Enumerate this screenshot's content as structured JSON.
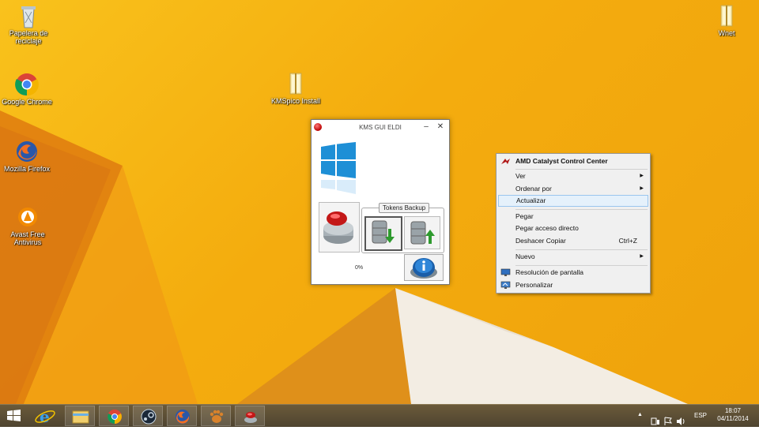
{
  "desktop": {
    "icons": [
      {
        "label": "Papelera de reciclaje",
        "icon": "recycle-bin-icon"
      },
      {
        "label": "Google Chrome",
        "icon": "chrome-icon"
      },
      {
        "label": "Mozilla Firefox",
        "icon": "firefox-icon"
      },
      {
        "label": "Avast Free Antivirus",
        "icon": "avast-icon"
      },
      {
        "label": "KMSpico Install",
        "icon": "folder-icon"
      },
      {
        "label": "Wnet",
        "icon": "folder-icon"
      }
    ]
  },
  "kms_window": {
    "title": "KMS GUI ELDI",
    "minimize": "–",
    "close": "✕",
    "tokens_label": "Tokens Backup",
    "progress": "0%",
    "progress_value": 0
  },
  "context_menu": {
    "items": [
      {
        "label": "AMD Catalyst Control Center",
        "bold": true,
        "icon": "amd-icon"
      },
      {
        "label": "Ver",
        "submenu": true
      },
      {
        "label": "Ordenar por",
        "submenu": true
      },
      {
        "label": "Actualizar",
        "highlighted": true
      },
      {
        "label": "Pegar"
      },
      {
        "label": "Pegar acceso directo"
      },
      {
        "label": "Deshacer Copiar",
        "shortcut": "Ctrl+Z"
      },
      {
        "label": "Nuevo",
        "submenu": true
      },
      {
        "label": "Resolución de pantalla",
        "icon": "display-icon"
      },
      {
        "label": "Personalizar",
        "icon": "personalize-icon"
      }
    ]
  },
  "taskbar": {
    "apps": [
      "start-icon",
      "internet-explorer-icon",
      "file-explorer-icon",
      "chrome-icon",
      "steam-icon",
      "firefox-icon",
      "paw-app-icon",
      "kms-app-icon"
    ],
    "tray": {
      "chevron": "▲",
      "language": "ESP",
      "time": "18:07",
      "date": "04/11/2014"
    }
  },
  "colors": {
    "wallpaper": "#f5b114",
    "taskbar": "#5a4c34",
    "menu_highlight": "#e5f1fb",
    "windows_blue": "#1e8fd6"
  }
}
